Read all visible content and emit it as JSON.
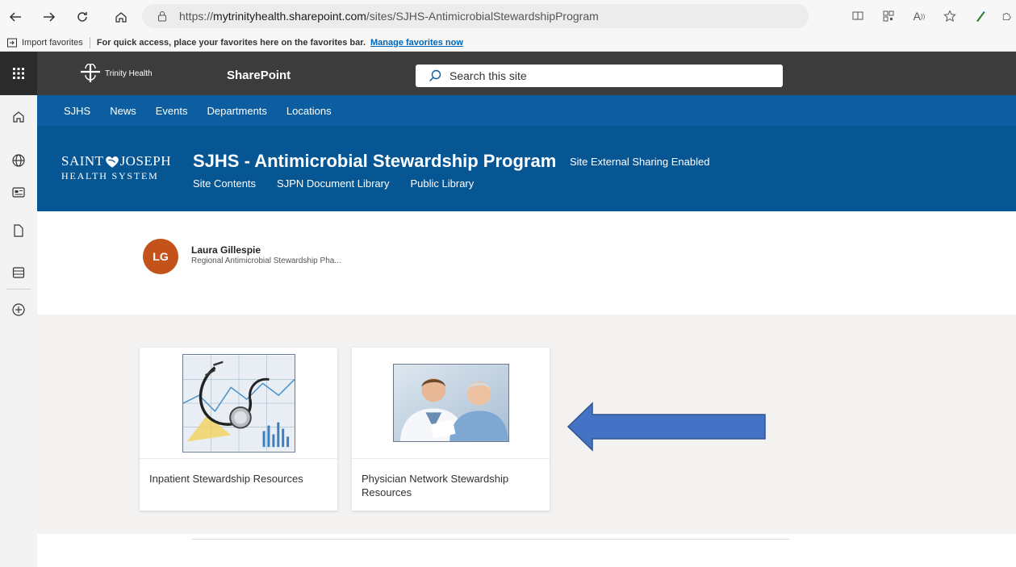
{
  "browser": {
    "url_prefix": "https://",
    "url_domain": "mytrinityhealth.sharepoint.com",
    "url_path": "/sites/SJHS-AntimicrobialStewardshipProgram"
  },
  "favorites_bar": {
    "import_label": "Import favorites",
    "message": "For quick access, place your favorites here on the favorites bar.",
    "manage_link": "Manage favorites now"
  },
  "suite": {
    "logo_text": "Trinity Health",
    "app_name": "SharePoint",
    "search_placeholder": "Search this site"
  },
  "hub_nav": [
    "SJHS",
    "News",
    "Events",
    "Departments",
    "Locations"
  ],
  "site": {
    "logo_line1_a": "SAINT",
    "logo_line1_b": "JOSEPH",
    "logo_line2": "HEALTH SYSTEM",
    "title": "SJHS - Antimicrobial Stewardship Program",
    "sharing": "Site External Sharing Enabled",
    "links": [
      "Site Contents",
      "SJPN Document Library",
      "Public Library"
    ]
  },
  "person": {
    "initials": "LG",
    "name": "Laura Gillespie",
    "role": "Regional Antimicrobial Stewardship Pha..."
  },
  "cards": [
    {
      "label": "Inpatient Stewardship Resources",
      "image": "stethoscope-chart"
    },
    {
      "label": "Physician Network Stewardship Resources",
      "image": "doctor-patient"
    }
  ],
  "colors": {
    "suite_bar": "#3c3c3c",
    "hub_nav": "#0c5ea1",
    "site_header": "#075694",
    "avatar": "#c3531b",
    "arrow_fill": "#4472c4",
    "arrow_stroke": "#2f528f"
  }
}
